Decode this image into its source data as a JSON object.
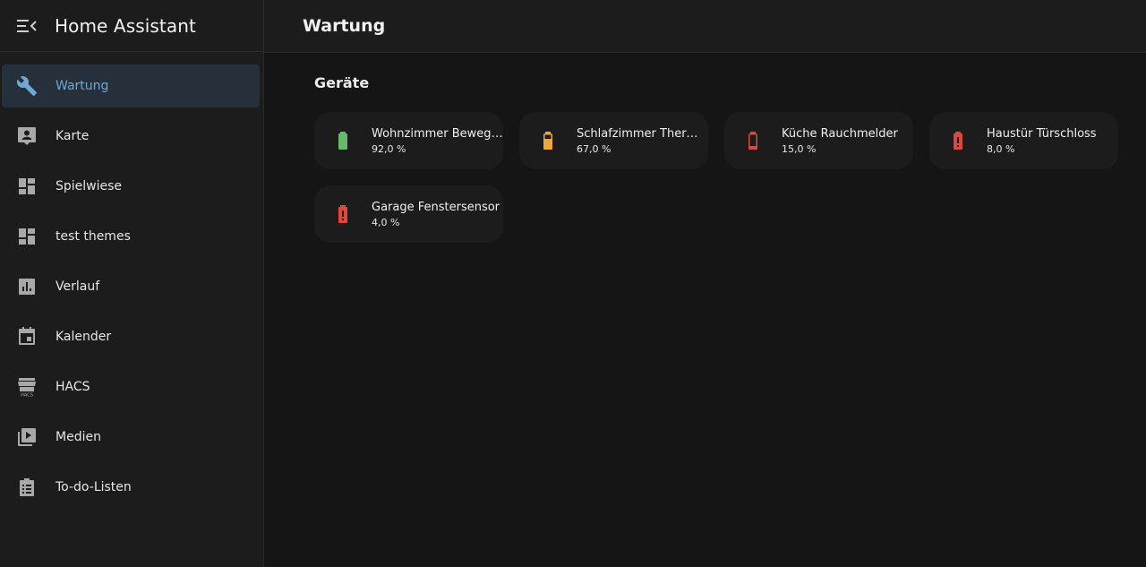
{
  "app": {
    "title": "Home Assistant"
  },
  "sidebar": {
    "items": [
      {
        "label": "Wartung",
        "icon": "wrench-icon",
        "active": true
      },
      {
        "label": "Karte",
        "icon": "map-account-icon"
      },
      {
        "label": "Spielwiese",
        "icon": "dashboard-icon"
      },
      {
        "label": "test themes",
        "icon": "dashboard-icon"
      },
      {
        "label": "Verlauf",
        "icon": "chart-box-icon"
      },
      {
        "label": "Kalender",
        "icon": "calendar-icon"
      },
      {
        "label": "HACS",
        "icon": "hacs-store-icon"
      },
      {
        "label": "Medien",
        "icon": "play-box-multiple-icon"
      },
      {
        "label": "To-do-Listen",
        "icon": "clipboard-list-icon"
      }
    ]
  },
  "main": {
    "title": "Wartung",
    "section_title": "Geräte",
    "devices": [
      {
        "name": "Wohnzimmer Bewegungsmelder",
        "value": "92,0 %",
        "color": "#66bb6a",
        "icon": "battery-full-icon"
      },
      {
        "name": "Schlafzimmer Thermostat",
        "value": "67,0 %",
        "color": "#f0a830",
        "icon": "battery-medium-icon"
      },
      {
        "name": "Küche Rauchmelder",
        "value": "15,0 %",
        "color": "#e0473c",
        "icon": "battery-low-icon"
      },
      {
        "name": "Haustür Türschloss",
        "value": "8,0 %",
        "color": "#e0473c",
        "icon": "battery-alert-icon"
      },
      {
        "name": "Garage Fenstersensor",
        "value": "4,0 %",
        "color": "#e0473c",
        "icon": "battery-alert-icon"
      }
    ]
  },
  "colors": {
    "accent": "#6da9d8",
    "active_bg": "#26303b",
    "sidebar_bg": "#1c1c1c"
  }
}
